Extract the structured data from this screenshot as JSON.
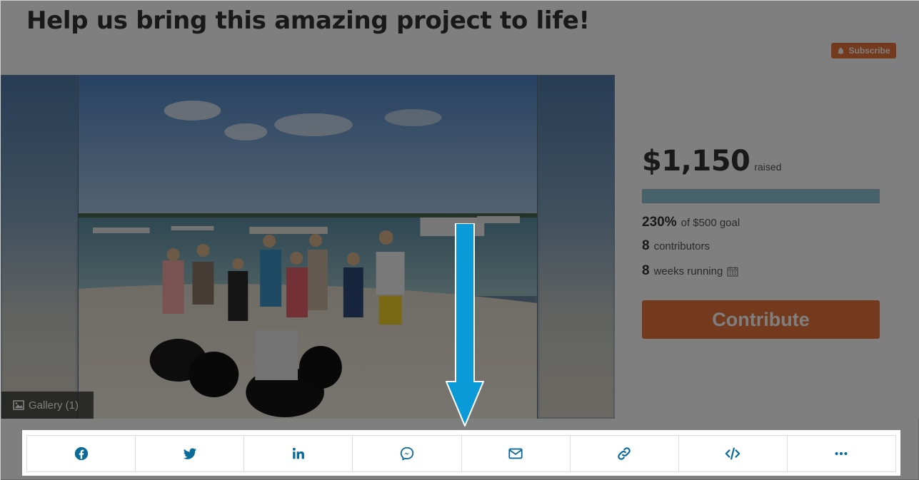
{
  "header": {
    "title": "Help us bring this amazing project to life!",
    "subscribe_label": "Subscribe"
  },
  "media": {
    "gallery_label": "Gallery (1)"
  },
  "stats": {
    "raised_amount": "$1,150",
    "raised_label": "raised",
    "progress_percent": 100,
    "goal_percent": "230%",
    "goal_text": "of $500 goal",
    "contributors_count": "8",
    "contributors_label": "contributors",
    "weeks_count": "8",
    "weeks_label": "weeks running",
    "contribute_label": "Contribute"
  },
  "share": {
    "items": [
      {
        "icon": "facebook-icon"
      },
      {
        "icon": "twitter-icon"
      },
      {
        "icon": "linkedin-icon"
      },
      {
        "icon": "messenger-icon"
      },
      {
        "icon": "email-icon"
      },
      {
        "icon": "link-icon"
      },
      {
        "icon": "embed-code-icon"
      },
      {
        "icon": "more-icon"
      }
    ]
  },
  "colors": {
    "accent_orange": "#e8743b",
    "share_icon_blue": "#0a6a9a",
    "progress_fill": "#8dc6d6",
    "arrow_blue": "#0a9ad8",
    "overlay": "rgba(0,0,0,0.5)"
  }
}
